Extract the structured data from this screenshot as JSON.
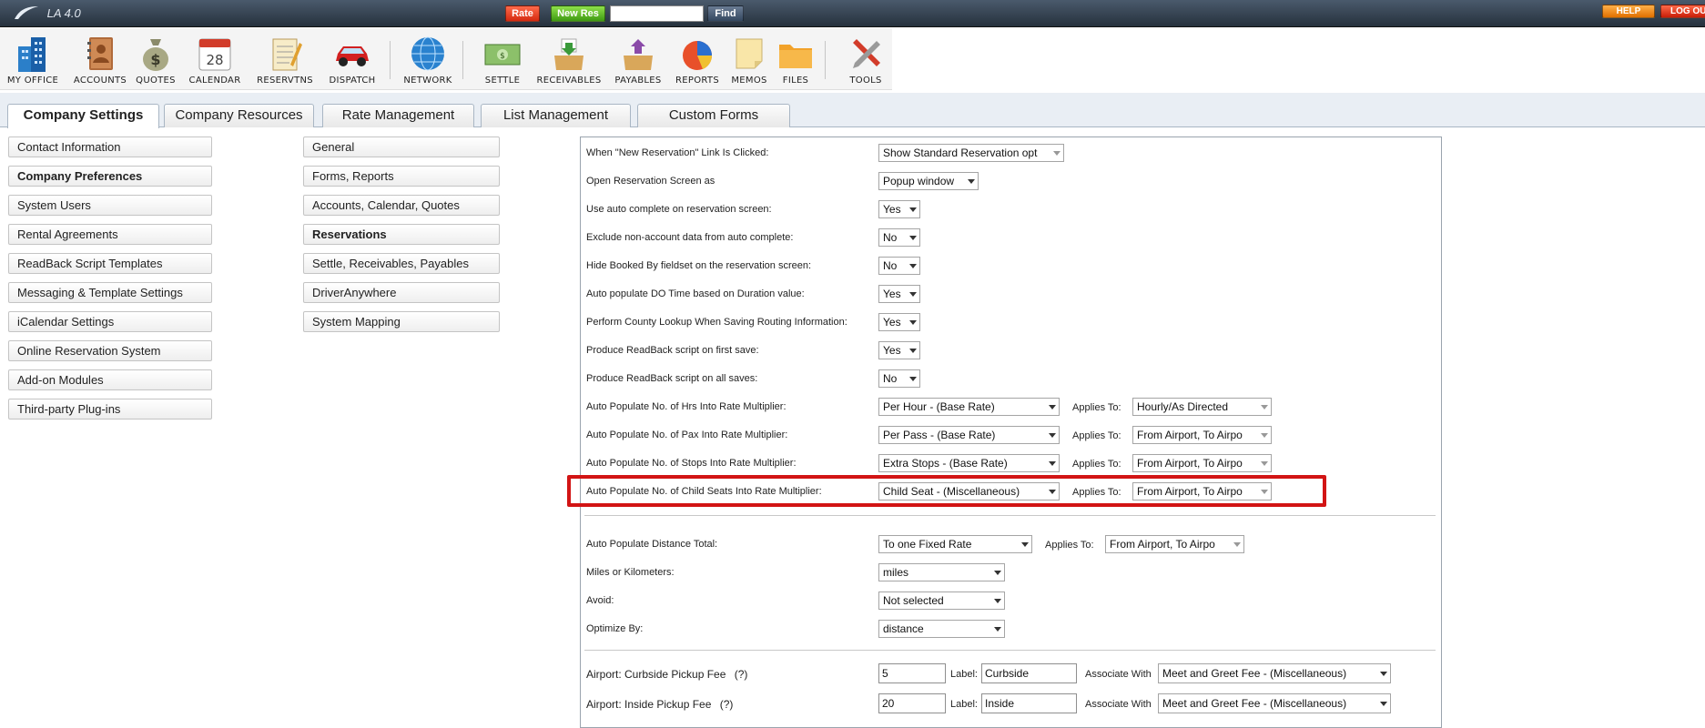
{
  "app": {
    "logo_text": "LA 4.0"
  },
  "topbar": {
    "rate_label": "Rate",
    "new_res_label": "New Res",
    "find_value": "",
    "find_label": "Find",
    "help_label": "HELP",
    "logout_label": "LOG OUT"
  },
  "toolbar": [
    {
      "label": "MY OFFICE",
      "icon": "office-building-icon"
    },
    {
      "label": "ACCOUNTS",
      "icon": "address-book-icon"
    },
    {
      "label": "QUOTES",
      "icon": "money-bag-icon"
    },
    {
      "label": "CALENDAR",
      "icon": "calendar-icon",
      "day": "28"
    },
    {
      "label": "RESERVTNS",
      "icon": "notepad-icon"
    },
    {
      "label": "DISPATCH",
      "icon": "car-icon"
    },
    {
      "label": "NETWORK",
      "icon": "globe-icon"
    },
    {
      "label": "SETTLE",
      "icon": "cash-icon"
    },
    {
      "label": "RECEIVABLES",
      "icon": "inbox-in-icon"
    },
    {
      "label": "PAYABLES",
      "icon": "inbox-out-icon"
    },
    {
      "label": "REPORTS",
      "icon": "pie-chart-icon"
    },
    {
      "label": "MEMOS",
      "icon": "sticky-note-icon"
    },
    {
      "label": "FILES",
      "icon": "folder-icon"
    },
    {
      "label": "TOOLS",
      "icon": "tools-icon"
    }
  ],
  "tabs": [
    {
      "label": "Company Settings",
      "active": true
    },
    {
      "label": "Company Resources"
    },
    {
      "label": "Rate Management"
    },
    {
      "label": "List Management"
    },
    {
      "label": "Custom Forms"
    }
  ],
  "left_nav": [
    "Contact Information",
    "Company Preferences",
    "System Users",
    "Rental Agreements",
    "ReadBack Script Templates",
    "Messaging & Template Settings",
    "iCalendar Settings",
    "Online Reservation System",
    "Add-on Modules",
    "Third-party Plug-ins"
  ],
  "sub_nav": [
    "General",
    "Forms, Reports",
    "Accounts, Calendar, Quotes",
    "Reservations",
    "Settle, Receivables, Payables",
    "DriverAnywhere",
    "System Mapping"
  ],
  "settings": {
    "new_res_link": {
      "label": "When \"New Reservation\" Link Is Clicked:",
      "value": "Show Standard Reservation opt"
    },
    "open_res_screen": {
      "label": "Open Reservation Screen as",
      "value": "Popup window"
    },
    "auto_complete": {
      "label": "Use auto complete on reservation screen:",
      "value": "Yes"
    },
    "exclude_non_account": {
      "label": "Exclude non-account data from auto complete:",
      "value": "No"
    },
    "hide_booked_by": {
      "label": "Hide Booked By fieldset on the reservation screen:",
      "value": "No"
    },
    "auto_do_time": {
      "label": "Auto populate DO Time based on Duration value:",
      "value": "Yes"
    },
    "county_lookup": {
      "label": "Perform County Lookup When Saving Routing Information:",
      "value": "Yes"
    },
    "readback_first": {
      "label": "Produce ReadBack script on first save:",
      "value": "Yes"
    },
    "readback_all": {
      "label": "Produce ReadBack script on all saves:",
      "value": "No"
    },
    "applies_to_label": "Applies To:",
    "hrs_multiplier": {
      "label": "Auto Populate No. of Hrs Into Rate Multiplier:",
      "value": "Per Hour - (Base Rate)",
      "applies": "Hourly/As Directed"
    },
    "pax_multiplier": {
      "label": "Auto Populate No. of Pax Into Rate Multiplier:",
      "value": "Per Pass - (Base Rate)",
      "applies": "From Airport, To Airpo"
    },
    "stops_multiplier": {
      "label": "Auto Populate No. of Stops Into Rate Multiplier:",
      "value": "Extra Stops - (Base Rate)",
      "applies": "From Airport, To Airpo"
    },
    "child_seats_multiplier": {
      "label": "Auto Populate No. of Child Seats Into Rate Multiplier:",
      "value": "Child Seat - (Miscellaneous)",
      "applies": "From Airport, To Airpo"
    },
    "distance_total": {
      "label": "Auto Populate Distance Total:",
      "value": "To one Fixed Rate",
      "applies": "From Airport, To Airpo"
    },
    "miles_km": {
      "label": "Miles or Kilometers:",
      "value": "miles"
    },
    "avoid": {
      "label": "Avoid:",
      "value": "Not selected"
    },
    "optimize_by": {
      "label": "Optimize By:",
      "value": "distance"
    },
    "fee_label_text": "Label:",
    "associate_with_text": "Associate With",
    "curbside_fee": {
      "label": "Airport: Curbside Pickup Fee",
      "help": "(?)",
      "amount": "5",
      "fee_label": "Curbside",
      "associate": "Meet and Greet Fee - (Miscellaneous)"
    },
    "inside_fee": {
      "label": "Airport: Inside Pickup Fee",
      "help": "(?)",
      "amount": "20",
      "fee_label": "Inside",
      "associate": "Meet and Greet Fee - (Miscellaneous)"
    }
  },
  "colors": {
    "highlight_box": "#d21414",
    "topbar": "#26313d",
    "tab_border": "#a9b6c4"
  }
}
